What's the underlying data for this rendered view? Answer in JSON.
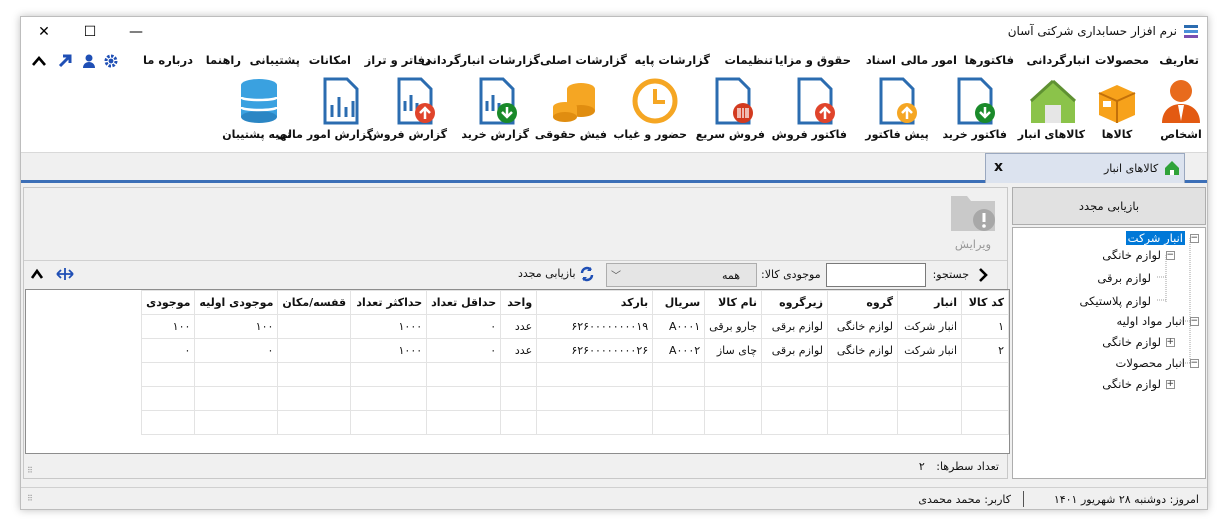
{
  "window": {
    "title": "نرم افزار حسابداری شرکتی آسان",
    "minimize": "—",
    "maximize": "☐",
    "close": "✕"
  },
  "menu": [
    "تعاریف",
    "محصولات",
    "انبارگردانی",
    "فاکتورها",
    "امور مالی",
    "اسناد",
    "حقوق و مزایا",
    "تنظیمات",
    "گزارشات پایه",
    "گزارشات اصلی",
    "گزارشات انبارگردانی",
    "دفاتر و تراز",
    "امکانات",
    "پشتیبانی",
    "راهنما",
    "درباره ما"
  ],
  "ribbon": [
    "اشخاص",
    "کالاها",
    "کالاهای انبار",
    "فاکتور خرید",
    "پیش فاکتور",
    "فاکتور فروش",
    "فروش سریع",
    "حضور و غیاب",
    "فیش حقوقی",
    "گزارش خرید",
    "گزارش فروش",
    "گزارش امور مالی",
    "تهیه پشتیبان"
  ],
  "tab": {
    "label": "کالاهای انبار",
    "close": "x"
  },
  "toolbar": {
    "edit": "ویرایش"
  },
  "search": {
    "label": "جستجو:",
    "value": "",
    "stock_label": "موجودی کالا:",
    "stock_value": "همه",
    "reload": "بازیابی مجدد"
  },
  "table": {
    "headers": [
      "کد کالا",
      "انبار",
      "گروه",
      "زیرگروه",
      "نام کالا",
      "سریال",
      "بارکد",
      "واحد",
      "حداقل تعداد",
      "حداکثر تعداد",
      "قفسه/مکان",
      "موجودی اولیه",
      "موجودی"
    ],
    "rows": [
      [
        "۱",
        "انبار شرکت",
        "لوازم خانگی",
        "لوازم برقی",
        "جارو برقی",
        "A۰۰۰۱",
        "۶۲۶۰۰۰۰۰۰۰۰۱۹",
        "عدد",
        "۰",
        "۱۰۰۰",
        "",
        "۱۰۰",
        "۱۰۰"
      ],
      [
        "۲",
        "انبار شرکت",
        "لوازم خانگی",
        "لوازم برقی",
        "چای ساز",
        "A۰۰۰۲",
        "۶۲۶۰۰۰۰۰۰۰۰۲۶",
        "عدد",
        "۰",
        "۱۰۰۰",
        "",
        "۰",
        "۰"
      ]
    ]
  },
  "row_count": {
    "label": "تعداد سطرها:",
    "value": "۲"
  },
  "sidebar": {
    "reload": "بازیابی مجدد"
  },
  "tree": [
    {
      "label": "انبار شرکت",
      "selected": true
    },
    {
      "label": "لوازم خانگی"
    },
    {
      "label": "لوازم برقی"
    },
    {
      "label": "لوازم پلاستیکی"
    },
    {
      "label": "انبار مواد اولیه"
    },
    {
      "label": "لوازم خانگی"
    },
    {
      "label": "انبار محصولات"
    },
    {
      "label": "لوازم خانگی"
    }
  ],
  "status": {
    "date": "امروز: دوشنبه ۲۸ شهریور ۱۴۰۱",
    "user": "کاربر: محمد محمدی"
  }
}
